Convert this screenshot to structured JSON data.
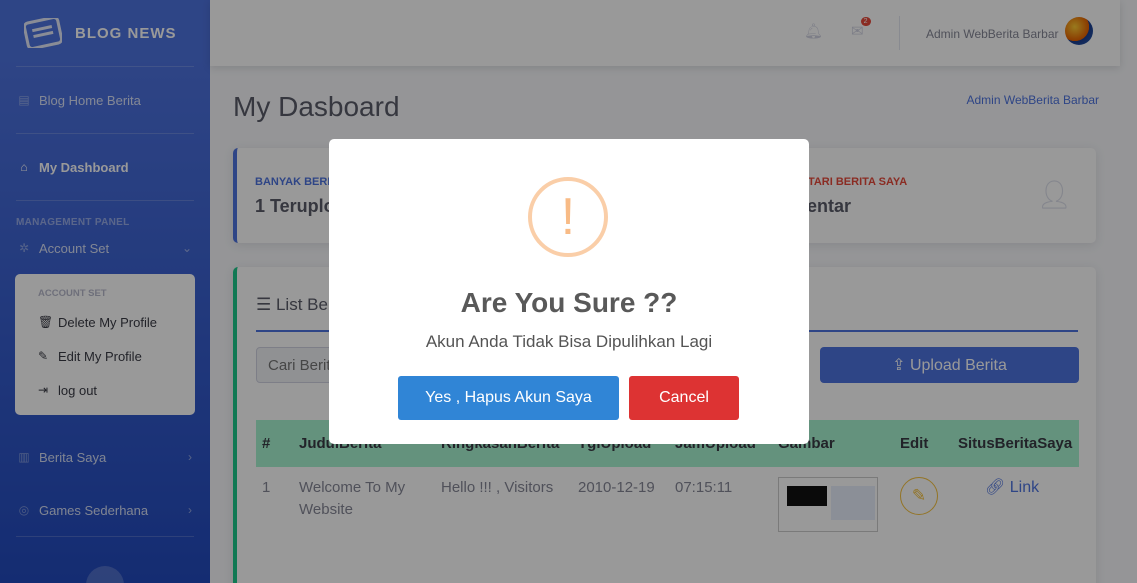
{
  "sidebar": {
    "brand": "BLOG NEWS",
    "home": "Blog Home Berita",
    "dashboard": "My Dashboard",
    "heading": "MANAGEMENT PANEL",
    "account_set": "Account Set",
    "collapse_header": "ACCOUNT SET",
    "delete_profile": "Delete My Profile",
    "edit_profile": "Edit My Profile",
    "logout": "log out",
    "berita_saya": "Berita Saya",
    "games": "Games Sederhana"
  },
  "topbar": {
    "message_count": "2",
    "user_name": "Admin WebBerita Barbar"
  },
  "main": {
    "page_title": "My Dasboard",
    "page_right": "Admin WebBerita Barbar",
    "stat1_label": "BANYAK BERITA",
    "stat1_value": "1 Terupload",
    "stat2_label": "KOMENTARI BERITA SAYA",
    "stat2_value": "Komentar",
    "list_title": "List Berita",
    "search_placeholder": "Cari Berita",
    "upload_label": "Upload Berita",
    "table": {
      "headers": [
        "#",
        "JudulBerita",
        "RingkasanBerita",
        "TglUpload",
        "JamUpload",
        "Gambar",
        "Edit",
        "SitusBeritaSaya"
      ],
      "rows": [
        {
          "no": "1",
          "judul": "Welcome To My Website",
          "ringkasan": "Hello !!! , Visitors",
          "tgl": "2010-12-19",
          "jam": "07:15:11",
          "link": "Link"
        }
      ]
    }
  },
  "modal": {
    "icon": "!",
    "title": "Are You Sure ??",
    "text": "Akun Anda Tidak Bisa Dipulihkan Lagi",
    "confirm": "Yes , Hapus Akun Saya",
    "cancel": "Cancel"
  },
  "colors": {
    "primary": "#4e73df",
    "success": "#1cc88a",
    "confirm": "#3085d6",
    "cancel": "#dd3333",
    "warning": "#f8bb86"
  }
}
